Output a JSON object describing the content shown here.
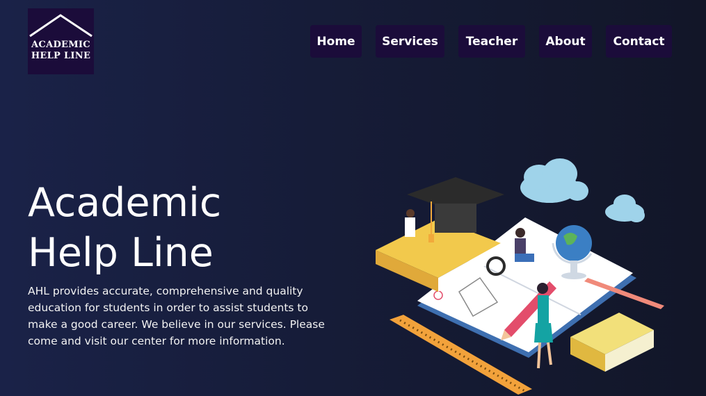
{
  "logo": {
    "line1": "ACADEMIC",
    "line2": "HELP LINE",
    "bg_color": "#1b0c3a"
  },
  "nav": {
    "items": [
      {
        "label": "Home"
      },
      {
        "label": "Services"
      },
      {
        "label": "Teacher"
      },
      {
        "label": "About"
      },
      {
        "label": "Contact"
      }
    ],
    "bg_color": "#1b0c3a"
  },
  "hero": {
    "title_line1": "Academic",
    "title_line2": "Help Line",
    "description": "AHL provides accurate, comprehensive and quality education for students in order to assist students to make a good career. We believe in our services. Please come and visit our center for more information."
  },
  "illustration": {
    "icon": "education-illustration",
    "colors": {
      "book": "#f2c94c",
      "cloud": "#9fd3ea",
      "cap": "#2a2a2a",
      "pencil": "#e34d6b",
      "person": "#14a3a3"
    }
  }
}
